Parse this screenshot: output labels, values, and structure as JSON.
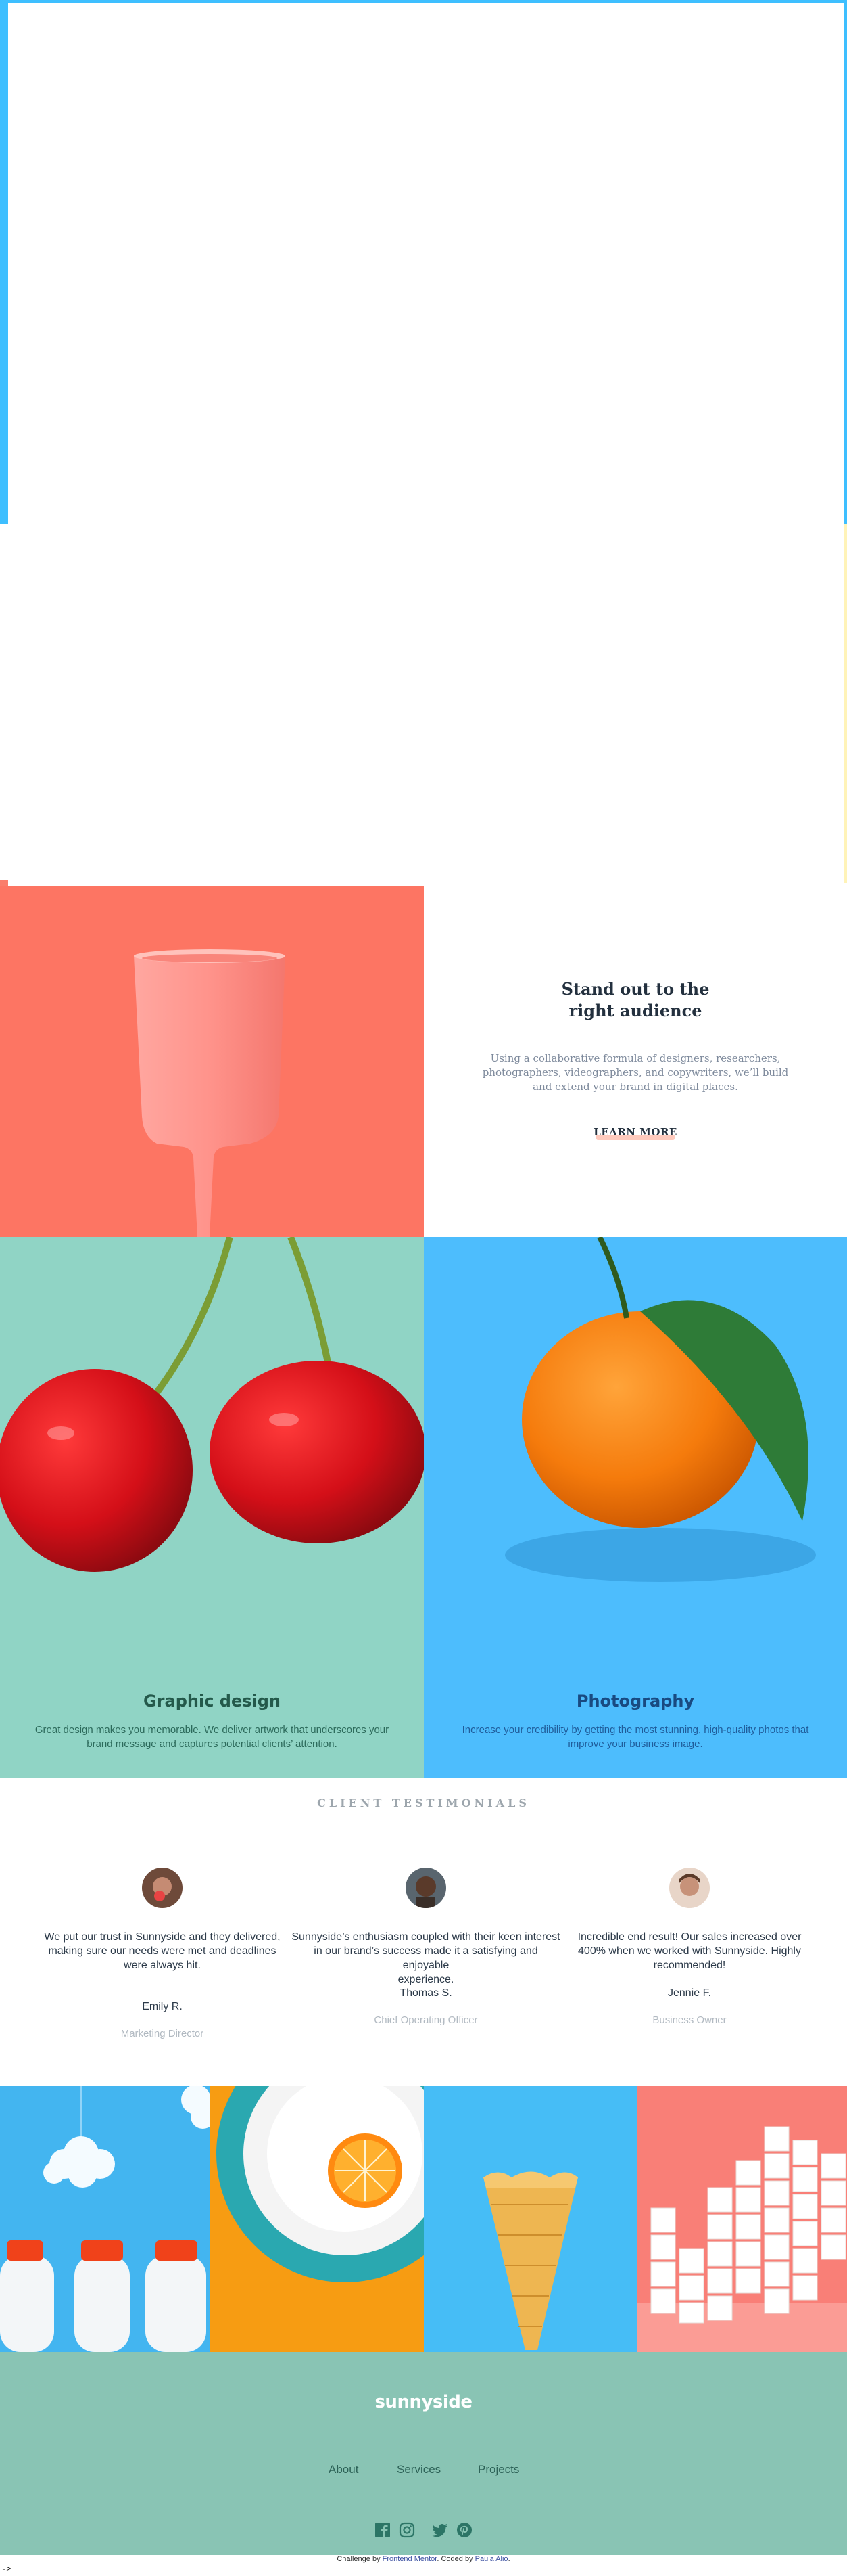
{
  "colors": {
    "sky_blue": "#3ebfff",
    "coral": "#fe6f5b",
    "mint": "#90d4c5",
    "blue": "#4dbdfd",
    "footer_green": "#89c4b4",
    "dark_text": "#23303e"
  },
  "standout": {
    "heading": "Stand out to the\nright audience",
    "text": "Using a collaborative formula of designers, researchers,\nphotographers, videographers, and copywriters, we’ll build\nand extend your brand in digital places.",
    "cta": "LEARN MORE"
  },
  "services": [
    {
      "title": "Graphic design",
      "text": "Great design makes you memorable. We deliver artwork that underscores your\nbrand message and captures potential clients’ attention."
    },
    {
      "title": "Photography",
      "text": "Increase your credibility by getting the most stunning, high-quality photos that\nimprove your business image."
    }
  ],
  "testimonials": {
    "heading": "CLIENT TESTIMONIALS",
    "items": [
      {
        "quote": "We put our trust in Sunnyside and they delivered,\nmaking sure our needs were met and deadlines\nwere always hit.",
        "name": "Emily R.",
        "role": "Marketing Director"
      },
      {
        "quote": "Sunnyside’s enthusiasm coupled with their keen interest\nin our brand’s success made it a satisfying and enjoyable\nexperience.",
        "name": "Thomas S.",
        "role": "Chief Operating Officer"
      },
      {
        "quote": "Incredible end result! Our sales increased over\n400% when we worked with Sunnyside. Highly\nrecommended!",
        "name": "Jennie F.",
        "role": "Business Owner"
      }
    ]
  },
  "footer": {
    "logo": "sunnyside",
    "nav": [
      "About",
      "Services",
      "Projects"
    ],
    "social_icons": [
      "facebook-icon",
      "instagram-icon",
      "twitter-icon",
      "pinterest-icon"
    ]
  },
  "attribution": {
    "prefix": "Challenge by ",
    "link1": "Frontend Mentor",
    "middle": ". Coded by ",
    "link2": "Paula Alio",
    "suffix": "."
  },
  "stray_text": "->"
}
